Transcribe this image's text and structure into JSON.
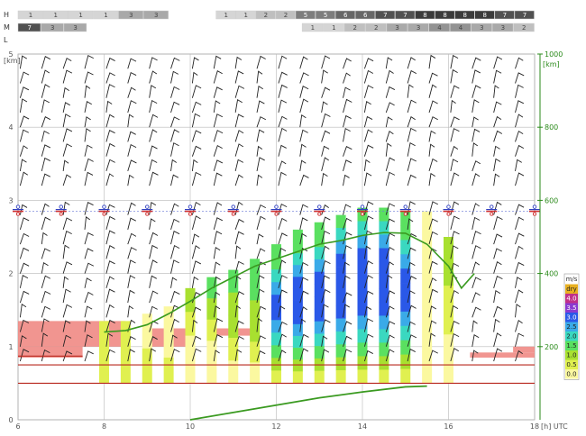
{
  "cloud_rows": {
    "labels": [
      "H",
      "M",
      "L"
    ],
    "H": {
      "segments": [
        {
          "x0": 6.0,
          "x1": 9.5,
          "values": [
            "1",
            "1",
            "1",
            "1",
            "3",
            "3"
          ]
        },
        {
          "x0": 10.6,
          "x1": 18.0,
          "values": [
            "1",
            "1",
            "2",
            "2",
            "5",
            "5",
            "6",
            "6",
            "7",
            "7",
            "8",
            "8",
            "8",
            "8",
            "7",
            "7"
          ]
        }
      ]
    },
    "M": {
      "segments": [
        {
          "x0": 6.0,
          "x1": 7.6,
          "values": [
            "7",
            "3",
            "3"
          ]
        },
        {
          "x0": 12.6,
          "x1": 18.0,
          "values": [
            "1",
            "1",
            "2",
            "2",
            "3",
            "3",
            "4",
            "4",
            "3",
            "3",
            "2"
          ]
        }
      ]
    },
    "L": {
      "segments": []
    }
  },
  "chart_data": {
    "type": "heatmap",
    "x_axis": {
      "range": [
        6,
        18
      ],
      "ticks": [
        "6",
        "8",
        "10",
        "12",
        "14",
        "16",
        "18"
      ],
      "unit_label": "[h] UTC"
    },
    "y_axis_left": {
      "range": [
        0,
        5
      ],
      "ticks": [
        "0",
        "1",
        "2",
        "3",
        "4",
        "5"
      ],
      "unit_label": "[km]"
    },
    "y_axis_right": {
      "range": [
        0,
        1000
      ],
      "ticks": [
        "200",
        "400",
        "600",
        "800",
        "1000"
      ],
      "unit_label": "[km]"
    },
    "legend": {
      "title": "m/s",
      "items": [
        {
          "label": "dry",
          "color": "#e8b020"
        },
        {
          "label": "4.0",
          "color": "#c0308a"
        },
        {
          "label": "3.5",
          "color": "#8a3ad0"
        },
        {
          "label": "3.0",
          "color": "#2a58e8"
        },
        {
          "label": "2.5",
          "color": "#3aaae8"
        },
        {
          "label": "2.0",
          "color": "#3ad8c0"
        },
        {
          "label": "1.5",
          "color": "#5ae060"
        },
        {
          "label": "1.0",
          "color": "#a8e030"
        },
        {
          "label": "0.5",
          "color": "#e0f050"
        },
        {
          "label": "0.0",
          "color": "#fbf8a0"
        }
      ]
    },
    "thermal_columns": [
      {
        "x": 7.5,
        "top": 0.3,
        "cells": [
          8
        ]
      },
      {
        "x": 8.0,
        "top": 1.35,
        "cells": [
          8,
          8
        ]
      },
      {
        "x": 8.5,
        "top": 1.35,
        "cells": [
          8,
          8
        ]
      },
      {
        "x": 9.0,
        "top": 1.45,
        "cells": [
          9,
          8
        ]
      },
      {
        "x": 9.5,
        "top": 1.55,
        "cells": [
          9,
          9,
          8
        ]
      },
      {
        "x": 10.0,
        "top": 1.8,
        "cells": [
          7,
          8,
          9,
          9
        ]
      },
      {
        "x": 10.5,
        "top": 1.95,
        "cells": [
          6,
          7,
          8,
          9,
          9
        ]
      },
      {
        "x": 11.0,
        "top": 2.05,
        "cells": [
          6,
          7,
          7,
          8,
          9
        ]
      },
      {
        "x": 11.5,
        "top": 2.2,
        "cells": [
          6,
          6,
          7,
          7,
          8,
          9
        ]
      },
      {
        "x": 12.0,
        "top": 2.4,
        "cells": [
          6,
          6,
          5,
          4,
          3,
          3,
          4,
          5,
          6,
          7,
          8
        ]
      },
      {
        "x": 12.5,
        "top": 2.6,
        "cells": [
          6,
          6,
          5,
          4,
          3,
          3,
          3,
          3,
          4,
          5,
          6,
          7,
          8
        ]
      },
      {
        "x": 13.0,
        "top": 2.7,
        "cells": [
          6,
          6,
          5,
          4,
          3,
          3,
          3,
          3,
          4,
          5,
          6,
          7,
          8
        ]
      },
      {
        "x": 13.5,
        "top": 2.8,
        "cells": [
          6,
          5,
          4,
          3,
          3,
          3,
          3,
          3,
          4,
          5,
          6,
          7,
          8
        ]
      },
      {
        "x": 14.0,
        "top": 2.9,
        "cells": [
          6,
          5,
          4,
          3,
          3,
          3,
          3,
          3,
          4,
          5,
          6,
          7,
          8
        ]
      },
      {
        "x": 14.5,
        "top": 2.9,
        "cells": [
          6,
          5,
          4,
          3,
          3,
          3,
          3,
          3,
          4,
          5,
          6,
          7,
          8
        ]
      },
      {
        "x": 15.0,
        "top": 2.85,
        "cells": [
          6,
          6,
          5,
          4,
          3,
          3,
          3,
          4,
          5,
          6,
          7,
          8
        ]
      },
      {
        "x": 15.5,
        "top": 2.85,
        "cells": [
          9,
          9,
          9,
          9,
          9,
          9,
          9,
          9,
          9,
          9,
          9
        ]
      },
      {
        "x": 16.0,
        "top": 2.5,
        "cells": [
          7,
          7,
          7,
          8,
          8,
          8,
          9,
          9,
          9
        ]
      }
    ],
    "bl_height_line": [
      {
        "x": 8.0,
        "y": 1.2
      },
      {
        "x": 8.5,
        "y": 1.22
      },
      {
        "x": 9.0,
        "y": 1.3
      },
      {
        "x": 9.5,
        "y": 1.45
      },
      {
        "x": 10.0,
        "y": 1.62
      },
      {
        "x": 10.5,
        "y": 1.8
      },
      {
        "x": 11.0,
        "y": 1.95
      },
      {
        "x": 11.5,
        "y": 2.1
      },
      {
        "x": 12.0,
        "y": 2.2
      },
      {
        "x": 12.5,
        "y": 2.3
      },
      {
        "x": 13.0,
        "y": 2.4
      },
      {
        "x": 13.5,
        "y": 2.45
      },
      {
        "x": 14.0,
        "y": 2.52
      },
      {
        "x": 14.5,
        "y": 2.56
      },
      {
        "x": 15.0,
        "y": 2.55
      },
      {
        "x": 15.5,
        "y": 2.4
      },
      {
        "x": 16.0,
        "y": 2.1
      },
      {
        "x": 16.3,
        "y": 1.8
      },
      {
        "x": 16.6,
        "y": 2.0
      }
    ],
    "distance_line": [
      {
        "x": 10.0,
        "y": 0.0
      },
      {
        "x": 11.0,
        "y": 0.1
      },
      {
        "x": 12.0,
        "y": 0.2
      },
      {
        "x": 13.0,
        "y": 0.3
      },
      {
        "x": 14.0,
        "y": 0.38
      },
      {
        "x": 15.0,
        "y": 0.45
      },
      {
        "x": 15.5,
        "y": 0.46
      }
    ],
    "low_cloud_bands": [
      {
        "x0": 6.0,
        "x1": 8.0,
        "y0": 1.0,
        "y1": 1.35
      },
      {
        "x0": 8.0,
        "x1": 8.5,
        "y0": 1.0,
        "y1": 1.35
      },
      {
        "x0": 9.0,
        "x1": 10.0,
        "y0": 1.0,
        "y1": 1.25
      },
      {
        "x0": 10.5,
        "x1": 11.5,
        "y0": 1.15,
        "y1": 1.25
      },
      {
        "x0": 6.0,
        "x1": 7.5,
        "y0": 0.85,
        "y1": 1.0
      },
      {
        "x0": 16.5,
        "x1": 18.0,
        "y0": 0.85,
        "y1": 0.92
      },
      {
        "x0": 17.5,
        "x1": 18.0,
        "y0": 0.92,
        "y1": 1.0
      }
    ],
    "tropopause_markers": {
      "y": 2.85,
      "x": [
        6,
        6.5,
        7,
        7.5,
        8,
        8.5,
        9,
        9.5,
        10,
        10.5,
        11,
        11.5,
        12,
        12.5,
        13,
        13.5,
        14,
        14.5,
        15,
        15.5,
        16,
        16.5,
        17,
        17.5,
        18
      ]
    },
    "red_lines": [
      {
        "y": 0.5,
        "x0": 6.0,
        "x1": 18.0
      },
      {
        "y": 0.75,
        "x0": 6.0,
        "x1": 18.0
      },
      {
        "y": 0.87,
        "x0": 6.0,
        "x1": 7.5
      }
    ],
    "wind_barbs": {
      "x_step": 0.5,
      "levels": [
        0.8,
        1.0,
        1.2,
        1.4,
        1.6,
        1.8,
        2.0,
        2.2,
        2.4,
        2.6,
        2.8,
        3.2,
        3.4,
        3.6,
        3.8,
        4.0,
        4.2,
        4.4,
        4.6,
        4.8
      ]
    }
  }
}
